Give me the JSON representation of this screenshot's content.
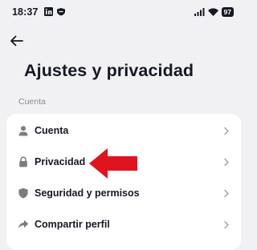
{
  "status_bar": {
    "time": "18:37",
    "battery": "97",
    "left_icons": [
      "linkedin-icon",
      "shield-app-icon"
    ],
    "right_icons": [
      "signal-icon",
      "wifi-icon",
      "battery-icon"
    ]
  },
  "header": {
    "back_icon": "back-arrow-icon",
    "title": "Ajustes y privacidad"
  },
  "section": {
    "label": "Cuenta",
    "items": [
      {
        "label": "Cuenta",
        "icon": "person-icon"
      },
      {
        "label": "Privacidad",
        "icon": "lock-icon"
      },
      {
        "label": "Seguridad y permisos",
        "icon": "shield-icon"
      },
      {
        "label": "Compartir perfil",
        "icon": "share-icon"
      }
    ]
  },
  "annotation": {
    "arrow_color": "#e0141e",
    "points_to": "Privacidad"
  },
  "colors": {
    "background": "#f1f1f3",
    "card": "#ffffff",
    "text": "#161823",
    "muted": "#8a8b91",
    "icon": "#7b7c80"
  }
}
